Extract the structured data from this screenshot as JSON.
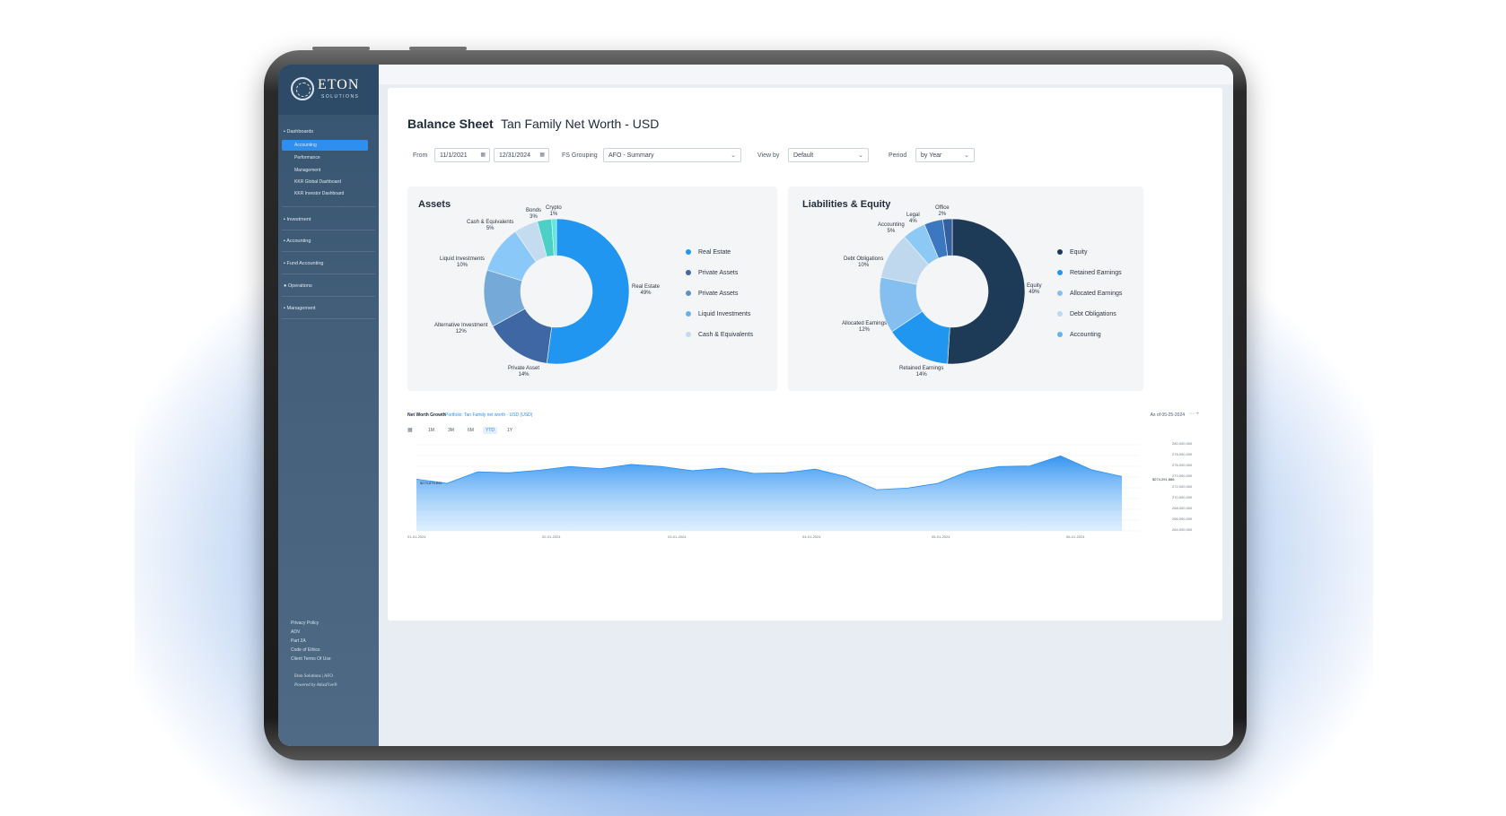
{
  "sidebar": {
    "brand": "ETON",
    "brand_sub": "SOLUTIONS",
    "sections": [
      {
        "label": "Dashboards"
      },
      {
        "label": "Investment"
      },
      {
        "label": "Accounting"
      },
      {
        "label": "Fund Accounting"
      },
      {
        "label": "Operations"
      },
      {
        "label": "Management"
      }
    ],
    "dashboard_items": [
      "Accounting",
      "Performance",
      "Management",
      "KKR Global Dashboard",
      "KKR Investor Dashboard"
    ],
    "footer_links": [
      "Privacy Policy",
      "ADV",
      "Part 2A",
      "Code of Ethics",
      "Client Terms Of Use"
    ],
    "footer_brand": "Eton Solutions | AFO",
    "footer_powered": "Powered by AtlasFive®"
  },
  "header": {
    "title": "Balance Sheet",
    "subtitle": "Tan Family Net Worth - USD"
  },
  "filters": {
    "from_label": "From",
    "from_value": "11/1/2021",
    "to_value": "12/31/2024",
    "grouping_label": "FS Grouping",
    "grouping_value": "AFO - Summary",
    "viewby_label": "View by",
    "viewby_value": "Default",
    "period_label": "Period",
    "period_value": "by Year"
  },
  "assets": {
    "title": "Assets",
    "slices": [
      {
        "name": "Real Estate",
        "pct": 49,
        "label": "Real Estate",
        "pct_label": "49%",
        "color": "#2196f0"
      },
      {
        "name": "Private Assets",
        "pct": 14,
        "label": "Private Asset",
        "pct_label": "14%",
        "color": "#3f67a3"
      },
      {
        "name": "Alternative Investment",
        "pct": 12,
        "label": "Alternative Investment",
        "pct_label": "12%",
        "color": "#75a9d8"
      },
      {
        "name": "Liquid Investments",
        "pct": 10,
        "label": "Liquid Investments",
        "pct_label": "10%",
        "color": "#8ac8f8"
      },
      {
        "name": "Cash & Equivalents",
        "pct": 5,
        "label": "Cash & Equivalents",
        "pct_label": "5%",
        "color": "#c4dcef"
      },
      {
        "name": "Bonds",
        "pct": 3,
        "label": "Bonds",
        "pct_label": "3%",
        "color": "#4ccfc4"
      },
      {
        "name": "Crypto",
        "pct": 1,
        "label": "Crypto",
        "pct_label": "1%",
        "color": "#5ee8dc"
      }
    ],
    "legend": [
      {
        "label": "Real Estate",
        "color": "#2196f0"
      },
      {
        "label": "Private Assets",
        "color": "#3f67a3"
      },
      {
        "label": "Private Assets",
        "color": "#5f8fc8"
      },
      {
        "label": "Liquid Investments",
        "color": "#63b3ee"
      },
      {
        "label": "Cash & Equivalents",
        "color": "#c4dcef"
      }
    ]
  },
  "liabilities": {
    "title": "Liabilities & Equity",
    "slices": [
      {
        "name": "Equity",
        "pct": 49,
        "label": "Equity",
        "pct_label": "49%",
        "color": "#1d3a56"
      },
      {
        "name": "Retained Earnings",
        "pct": 14,
        "label": "Retained Earnings",
        "pct_label": "14%",
        "color": "#2196f0"
      },
      {
        "name": "Allocated Earnings",
        "pct": 12,
        "label": "Allocated Earnings",
        "pct_label": "12%",
        "color": "#84bff0"
      },
      {
        "name": "Debt Obligations",
        "pct": 10,
        "label": "Debt Obligations",
        "pct_label": "10%",
        "color": "#c0d8ee"
      },
      {
        "name": "Accounting",
        "pct": 5,
        "label": "Accounting",
        "pct_label": "5%",
        "color": "#8ccaf5"
      },
      {
        "name": "Legal",
        "pct": 4,
        "label": "Legal",
        "pct_label": "4%",
        "color": "#3b78c0"
      },
      {
        "name": "Office",
        "pct": 2,
        "label": "Office",
        "pct_label": "2%",
        "color": "#3460a0"
      }
    ],
    "legend": [
      {
        "label": "Equity",
        "color": "#1d3a56"
      },
      {
        "label": "Retained Earnings",
        "color": "#2196f0"
      },
      {
        "label": "Allocated Earnings",
        "color": "#84bff0"
      },
      {
        "label": "Debt Obligations",
        "color": "#c0d8ee"
      },
      {
        "label": "Accounting",
        "color": "#63b3ee"
      }
    ]
  },
  "growth": {
    "title": "Net Worth Growth",
    "portfolio": "Portfolio: Tan Family net worth - USD (USD)",
    "as_of": "As of 05-25-2024",
    "ranges": [
      "1M",
      "3M",
      "6M",
      "YTD",
      "1Y"
    ],
    "active_range": "YTD",
    "start_value": "$273,875,840",
    "end_value": "$274,291,886",
    "y_ticks": [
      "280,000,000",
      "278,000,000",
      "276,000,000",
      "274,000,000",
      "272,000,000",
      "270,000,000",
      "268,000,000",
      "266,000,000",
      "264,000,000"
    ],
    "x_ticks": [
      "01-01-2024",
      "02-01-2024",
      "03-01-2024",
      "04-01-2024",
      "05-01-2024",
      "06-01-2024"
    ]
  },
  "chart_data": [
    {
      "type": "pie",
      "title": "Assets",
      "categories": [
        "Real Estate",
        "Private Asset",
        "Alternative Investment",
        "Liquid Investments",
        "Cash & Equivalents",
        "Bonds",
        "Crypto"
      ],
      "values": [
        49,
        14,
        12,
        10,
        5,
        3,
        1
      ]
    },
    {
      "type": "pie",
      "title": "Liabilities & Equity",
      "categories": [
        "Equity",
        "Retained Earnings",
        "Allocated Earnings",
        "Debt Obligations",
        "Accounting",
        "Legal",
        "Office"
      ],
      "values": [
        49,
        14,
        12,
        10,
        5,
        4,
        2
      ]
    },
    {
      "type": "area",
      "title": "Net Worth Growth",
      "ylim": [
        264000000,
        281000000
      ],
      "x": [
        "01-01-2024",
        "01-08-2024",
        "01-15-2024",
        "01-22-2024",
        "01-29-2024",
        "02-05-2024",
        "02-12-2024",
        "02-19-2024",
        "02-26-2024",
        "03-04-2024",
        "03-11-2024",
        "03-18-2024",
        "03-25-2024",
        "04-01-2024",
        "04-08-2024",
        "04-15-2024",
        "04-22-2024",
        "04-29-2024",
        "05-06-2024",
        "05-13-2024",
        "05-20-2024",
        "05-27-2024",
        "06-03-2024",
        "06-10-2024"
      ],
      "values": [
        273800000,
        273000000,
        275200000,
        275000000,
        275500000,
        276200000,
        275800000,
        276600000,
        276200000,
        275400000,
        275900000,
        274900000,
        275000000,
        275700000,
        274300000,
        271800000,
        272100000,
        273000000,
        275300000,
        276200000,
        276300000,
        278200000,
        275600000,
        274300000
      ]
    }
  ]
}
